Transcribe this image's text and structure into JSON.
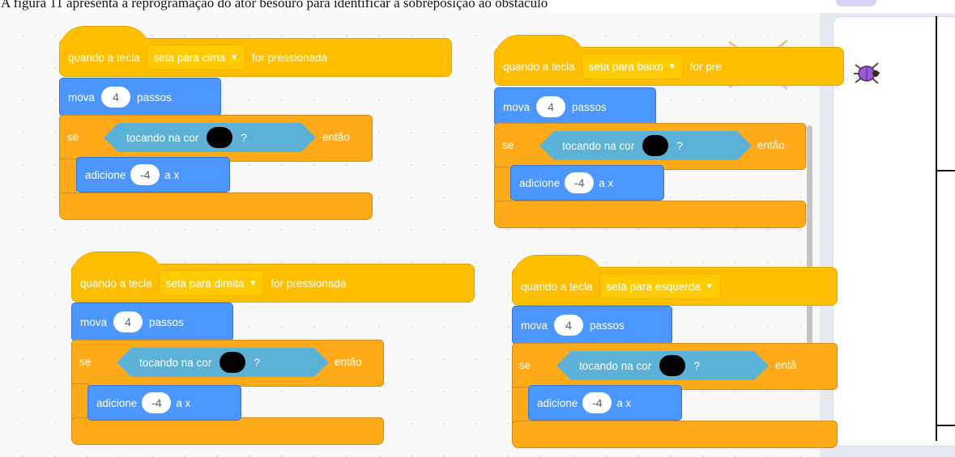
{
  "caption": "A figura 11 apresenta a reprogramação do ator besouro para identificar a sobreposição ao obstáculo",
  "stage": {
    "sprite_icon": "beetle-icon"
  },
  "scripts": [
    {
      "event_prefix": "quando a tecla",
      "key": "seta para cima",
      "event_suffix": "for pressionada",
      "move_label": "mova",
      "move_steps": "4",
      "move_unit": "passos",
      "if_label": "se",
      "sensing_label": "tocando na cor",
      "sensing_q": "?",
      "then_label": "então",
      "change_label": "adicione",
      "change_value": "-4",
      "change_target": "a x"
    },
    {
      "event_prefix": "quando a tecla",
      "key": "seta para baixo",
      "event_suffix": "for pre",
      "move_label": "mova",
      "move_steps": "4",
      "move_unit": "passos",
      "if_label": "se",
      "sensing_label": "tocando na cor",
      "sensing_q": "?",
      "then_label": "então",
      "change_label": "adicione",
      "change_value": "-4",
      "change_target": "a x"
    },
    {
      "event_prefix": "quando a tecla",
      "key": "seta para direita",
      "event_suffix": "for pressionada",
      "move_label": "mova",
      "move_steps": "4",
      "move_unit": "passos",
      "if_label": "se",
      "sensing_label": "tocando na cor",
      "sensing_q": "?",
      "then_label": "então",
      "change_label": "adicione",
      "change_value": "-4",
      "change_target": "a x"
    },
    {
      "event_prefix": "quando a tecla",
      "key": "seta para esquerda",
      "event_suffix": "",
      "move_label": "mova",
      "move_steps": "4",
      "move_unit": "passos",
      "if_label": "se",
      "sensing_label": "tocando na cor",
      "sensing_q": "?",
      "then_label": "entã",
      "change_label": "adicione",
      "change_value": "-4",
      "change_target": "a x"
    }
  ],
  "colors": {
    "events": "#ffbf00",
    "motion": "#4c97ff",
    "control": "#ffab19",
    "sensing": "#5cb1d6",
    "touch_color": "#000000"
  }
}
